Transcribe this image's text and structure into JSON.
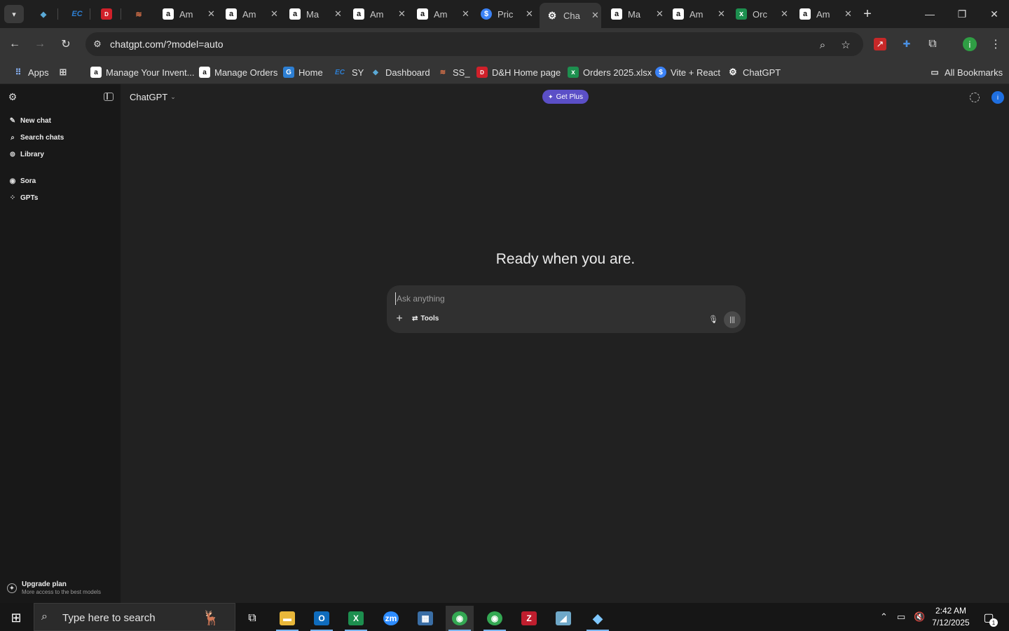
{
  "browser": {
    "tabs": [
      {
        "icon": "dashboard-favicon",
        "title": "",
        "color": "#5aa9d6",
        "glyph": "◆"
      },
      {
        "icon": "ec-favicon",
        "title": "",
        "color": "#2d7fd3",
        "glyph": "EC"
      },
      {
        "icon": "dh-favicon",
        "title": "",
        "color": "#d0202a",
        "glyph": "D"
      },
      {
        "icon": "ss-favicon",
        "title": "",
        "color": "#e0744a",
        "glyph": "≋"
      },
      {
        "icon": "amazon-favicon",
        "title": "Am",
        "color": "#ffffff",
        "glyph": "a"
      },
      {
        "icon": "amazon-favicon",
        "title": "Am",
        "color": "#ffffff",
        "glyph": "a"
      },
      {
        "icon": "amazon-favicon",
        "title": "Ma",
        "color": "#ffffff",
        "glyph": "a"
      },
      {
        "icon": "amazon-favicon",
        "title": "Am",
        "color": "#ffffff",
        "glyph": "a"
      },
      {
        "icon": "amazon-favicon",
        "title": "Am",
        "color": "#ffffff",
        "glyph": "a"
      },
      {
        "icon": "dollar-favicon",
        "title": "Pric",
        "color": "#3b82f6",
        "glyph": "$"
      },
      {
        "icon": "chatgpt-favicon",
        "title": "Cha",
        "color": "#ffffff",
        "glyph": "⚙",
        "active": true
      },
      {
        "icon": "amazon-favicon",
        "title": "Ma",
        "color": "#ffffff",
        "glyph": "a"
      },
      {
        "icon": "amazon-favicon",
        "title": "Am",
        "color": "#ffffff",
        "glyph": "a"
      },
      {
        "icon": "excel-favicon",
        "title": "Orc",
        "color": "#1d8f4f",
        "glyph": "x"
      },
      {
        "icon": "amazon-favicon",
        "title": "Am",
        "color": "#ffffff",
        "glyph": "a"
      }
    ],
    "url": "chatgpt.com/?model=auto",
    "bookmarks": [
      {
        "label": "Apps",
        "icon": "apps-grid-icon"
      },
      {
        "label": "Manage Your Invent...",
        "icon": "amazon-favicon"
      },
      {
        "label": "Manage Orders",
        "icon": "amazon-favicon"
      },
      {
        "label": "Home",
        "icon": "home-favicon"
      },
      {
        "label": "SY",
        "icon": "ec-favicon"
      },
      {
        "label": "Dashboard",
        "icon": "dashboard-favicon"
      },
      {
        "label": "SS_",
        "icon": "ss-favicon"
      },
      {
        "label": "D&H Home page",
        "icon": "dh-favicon"
      },
      {
        "label": "Orders 2025.xlsx",
        "icon": "excel-favicon"
      },
      {
        "label": "Vite + React",
        "icon": "dollar-favicon"
      },
      {
        "label": "ChatGPT",
        "icon": "chatgpt-favicon"
      }
    ],
    "all_bookmarks": "All Bookmarks",
    "profile_initial": "i"
  },
  "sidebar": {
    "items": [
      {
        "label": "New chat",
        "icon": "pencil-icon"
      },
      {
        "label": "Search chats",
        "icon": "search-icon"
      },
      {
        "label": "Library",
        "icon": "library-icon"
      },
      {
        "label": "Sora",
        "icon": "sora-icon"
      },
      {
        "label": "GPTs",
        "icon": "gpts-grid-icon"
      }
    ],
    "upgrade_title": "Upgrade plan",
    "upgrade_subtitle": "More access to the best models"
  },
  "main": {
    "model": "ChatGPT",
    "get_plus": "Get Plus",
    "headline": "Ready when you are.",
    "composer_placeholder": "Ask anything",
    "tools_label": "Tools",
    "profile_initial": "i"
  },
  "taskbar": {
    "search_placeholder": "Type here to search",
    "time": "2:42 AM",
    "date": "7/12/2025",
    "notification_count": "1"
  },
  "colors": {
    "accent_plus": "#5b4fc7",
    "profile_blue": "#1f6fe0",
    "profile_green": "#2f9e44"
  }
}
